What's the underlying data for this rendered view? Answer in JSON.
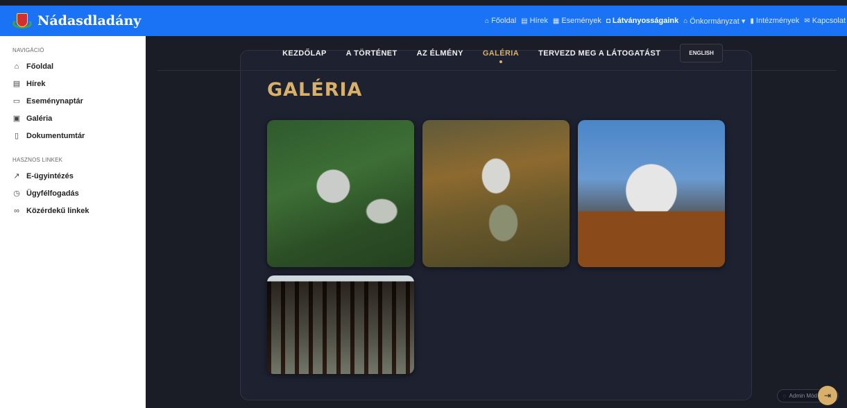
{
  "header": {
    "site_name": "Nádasdladány",
    "nav": [
      {
        "icon": "home-icon",
        "glyph": "⌂",
        "label": "Főoldal"
      },
      {
        "icon": "news-icon",
        "glyph": "▤",
        "label": "Hírek"
      },
      {
        "icon": "calendar-icon",
        "glyph": "▦",
        "label": "Események"
      },
      {
        "icon": "landmark-icon",
        "glyph": "◘",
        "label": "Látványosságaink"
      },
      {
        "icon": "bank-icon",
        "glyph": "⌂",
        "label": "Önkormányzat ▾"
      },
      {
        "icon": "building-icon",
        "glyph": "▮",
        "label": "Intézmények"
      },
      {
        "icon": "mail-icon",
        "glyph": "✉",
        "label": "Kapcsolat"
      }
    ],
    "active": "Látványosságaink"
  },
  "sidebar": {
    "nav_title": "NAVIGÁCIÓ",
    "nav_items": [
      {
        "icon": "home-icon",
        "glyph": "⌂",
        "label": "Főoldal"
      },
      {
        "icon": "news-icon",
        "glyph": "▤",
        "label": "Hírek"
      },
      {
        "icon": "calendar-icon",
        "glyph": "▭",
        "label": "Eseménynaptár"
      },
      {
        "icon": "image-icon",
        "glyph": "▣",
        "label": "Galéria"
      },
      {
        "icon": "document-icon",
        "glyph": "▯",
        "label": "Dokumentumtár"
      }
    ],
    "links_title": "HASZNOS LINKEK",
    "link_items": [
      {
        "icon": "external-link-icon",
        "glyph": "↗",
        "label": "E-ügyintézés"
      },
      {
        "icon": "clock-icon",
        "glyph": "◷",
        "label": "Ügyfélfogadás"
      },
      {
        "icon": "link-icon",
        "glyph": "∞",
        "label": "Közérdekű linkek"
      }
    ]
  },
  "subnav": {
    "items": [
      "KEZDŐLAP",
      "A TÖRTÉNET",
      "AZ ÉLMÉNY",
      "GALÉRIA",
      "TERVEZD MEG A LÁTOGATÁST"
    ],
    "active": "GALÉRIA",
    "language_button": "ENGLISH"
  },
  "gallery": {
    "title": "GALÉRIA",
    "image_count": 4
  },
  "admin": {
    "label": "Admin Mód",
    "button_icon": "exit-icon"
  },
  "colors": {
    "topbar": "#1a73f5",
    "accent_gold": "#d8b06a",
    "background": "#1b1d26"
  }
}
